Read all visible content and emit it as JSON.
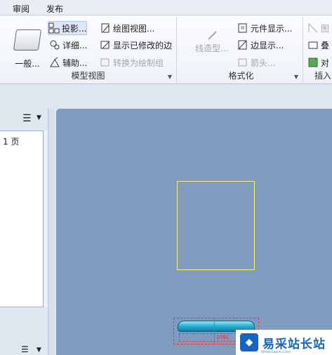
{
  "menu": {
    "review": "审阅",
    "publish": "发布"
  },
  "ribbon": {
    "model_views": {
      "general": "一般...",
      "projection": "投影...",
      "detailed": "详细...",
      "auxiliary": "辅助...",
      "drawing_view": "绘图视图...",
      "show_modified_edges": "显示已修改的边",
      "convert_to_draw_group": "转换为绘制组",
      "group_label": "模型视图"
    },
    "format": {
      "line_style": "线造型...",
      "component_display": "元件显示...",
      "edge_display": "边显示...",
      "arrow": "箭头...",
      "group_label": "格式化"
    },
    "insert": {
      "item1": "图",
      "item2": "叠",
      "item3": "对",
      "group_label": "插入"
    }
  },
  "sheets": {
    "page_label": "1 页"
  },
  "canvas": {
    "dim_label": "D7N1"
  },
  "watermark": {
    "text": "易采站长站",
    "sub": "Www.Easck.Com"
  },
  "icons": [
    "general-view-icon",
    "projection-icon",
    "detailed-icon",
    "auxiliary-icon",
    "drawing-view-icon",
    "modified-edges-icon",
    "convert-icon",
    "line-style-icon",
    "component-display-icon",
    "edge-display-icon",
    "arrow-icon",
    "list-icon",
    "chevron-down-icon"
  ],
  "colors": {
    "canvas": "#7f9bc0",
    "view_frame": "#f3f36a",
    "part": "#2bb6d9",
    "dash": "#e23a3a"
  }
}
